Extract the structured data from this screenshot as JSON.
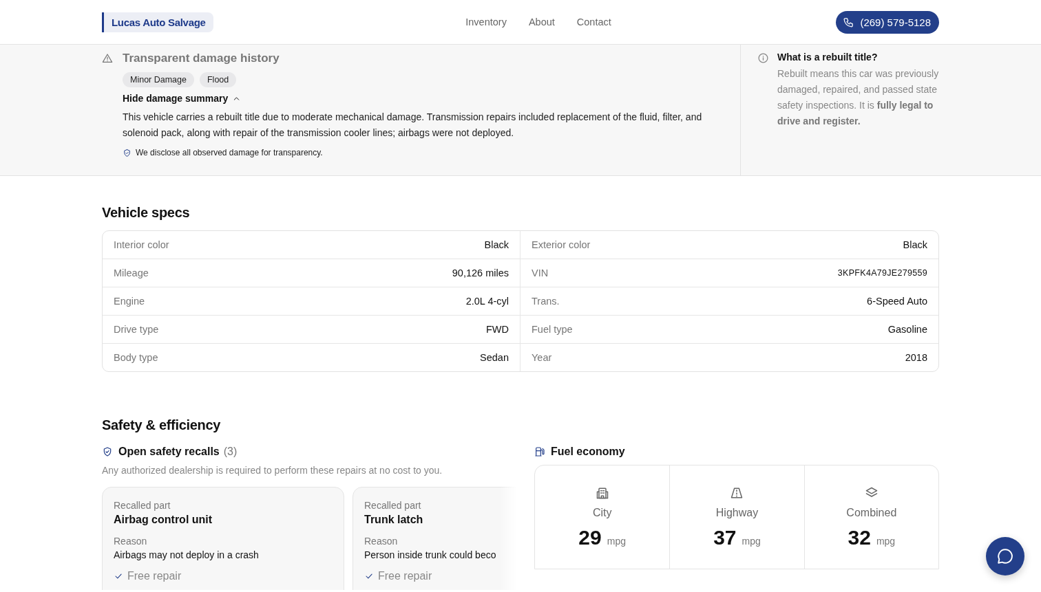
{
  "header": {
    "logo": "Lucas Auto Salvage",
    "nav": [
      {
        "label": "Inventory"
      },
      {
        "label": "About"
      },
      {
        "label": "Contact"
      }
    ],
    "phone": "(269) 579-5128"
  },
  "damage": {
    "title": "Transparent damage history",
    "tags": [
      "Minor Damage",
      "Flood"
    ],
    "summary_toggle": "Hide damage summary",
    "expanded": true,
    "summary": "This vehicle carries a rebuilt title due to moderate mechanical damage. Transmission repairs included replacement of the fluid, filter, and solenoid pack, along with repair of the transmission cooler lines; airbags were not deployed.",
    "note": "We disclose all observed damage for transparency.",
    "info_title": "What is a rebuilt title?",
    "info_text": "Rebuilt means this car was previously damaged, repaired, and passed state safety inspections. It is **fully legal to drive and register.**"
  },
  "specs": {
    "title": "Vehicle specs",
    "items": [
      {
        "label": "Interior color",
        "value": "Black"
      },
      {
        "label": "Exterior color",
        "value": "Black"
      },
      {
        "label": "Mileage",
        "value": "90,126 miles"
      },
      {
        "label": "VIN",
        "value": "3KPFK4A79JE279559",
        "kind": "code"
      },
      {
        "label": "Engine",
        "value": "2.0L 4-cyl"
      },
      {
        "label": "Trans.",
        "value": "6-Speed Auto"
      },
      {
        "label": "Drive type",
        "value": "FWD"
      },
      {
        "label": "Fuel type",
        "value": "Gasoline"
      },
      {
        "label": "Body type",
        "value": "Sedan"
      },
      {
        "label": "Year",
        "value": "2018"
      }
    ]
  },
  "safety": {
    "title": "Safety & efficiency",
    "recalls_title": "Open safety recalls",
    "recalls_count": "(3)",
    "recalls_note": "Any authorized dealership is required to perform these repairs at no cost to you.",
    "recalls": [
      {
        "part_label": "Recalled part",
        "part": "Airbag control unit",
        "reason_label": "Reason",
        "reason": "Airbags may not deploy in a crash",
        "remedy": "Free repair"
      },
      {
        "part_label": "Recalled part",
        "part": "Trunk latch",
        "reason_label": "Reason",
        "reason": "Person inside trunk could beco",
        "remedy": "Free repair"
      }
    ],
    "fuel_title": "Fuel economy",
    "fuel": [
      {
        "kind": "city",
        "label": "City",
        "value": "29",
        "unit": "mpg"
      },
      {
        "kind": "highway",
        "label": "Highway",
        "value": "37",
        "unit": "mpg"
      },
      {
        "kind": "combined",
        "label": "Combined",
        "value": "32",
        "unit": "mpg"
      }
    ]
  }
}
